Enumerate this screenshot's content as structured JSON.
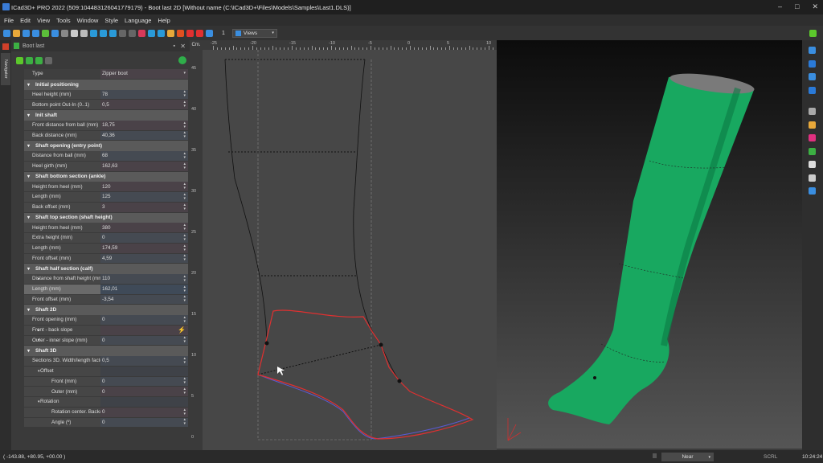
{
  "window": {
    "title": "ICad3D+ PRO 2022 (509:104483126041779179) - Boot last 2D [Without name (C:\\ICad3D+\\Files\\Models\\Samples\\Last1.DLS)]"
  },
  "menu": [
    "File",
    "Edit",
    "View",
    "Tools",
    "Window",
    "Style",
    "Language",
    "Help"
  ],
  "toolbar": {
    "spin_value": "1",
    "views_label": "Views"
  },
  "nav_tab": "Navigator",
  "panel": {
    "title": "Boot last",
    "type_label": "Type",
    "type_value": "Zipper boot"
  },
  "properties": [
    {
      "kind": "section",
      "label": "Initial positioning"
    },
    {
      "kind": "field",
      "label": "Heel height (mm)",
      "value": "78"
    },
    {
      "kind": "field",
      "label": "Bottom point Out-In (0..1)",
      "value": "0,5"
    },
    {
      "kind": "section",
      "label": "Init shaft"
    },
    {
      "kind": "field",
      "label": "Front distance from ball (mm)",
      "value": "18,75"
    },
    {
      "kind": "field",
      "label": "Back distance (mm)",
      "value": "40,36"
    },
    {
      "kind": "section",
      "label": "Shaft opening (entry point)"
    },
    {
      "kind": "field",
      "label": "Distance from ball (mm)",
      "value": "68"
    },
    {
      "kind": "field",
      "label": "Heel girth (mm)",
      "value": "162,63"
    },
    {
      "kind": "section",
      "label": "Shaft bottom section (ankle)"
    },
    {
      "kind": "field",
      "label": "Height from heel (mm)",
      "value": "120"
    },
    {
      "kind": "field",
      "label": "Length (mm)",
      "value": "125"
    },
    {
      "kind": "field",
      "label": "Back offset (mm)",
      "value": "3"
    },
    {
      "kind": "section",
      "label": "Shaft top section (shaft height)"
    },
    {
      "kind": "field",
      "label": "Height from heel (mm)",
      "value": "380"
    },
    {
      "kind": "field",
      "label": "Extra height (mm)",
      "value": "0"
    },
    {
      "kind": "field",
      "label": "Length (mm)",
      "value": "174,59"
    },
    {
      "kind": "field",
      "label": "Front offset (mm)",
      "value": "4,59"
    },
    {
      "kind": "section",
      "label": "Shaft half section (calf)"
    },
    {
      "kind": "field",
      "label": "Distance from shaft height (mm)",
      "value": "110",
      "expand": true
    },
    {
      "kind": "field",
      "label": "Length (mm)",
      "value": "162,01",
      "selected": true
    },
    {
      "kind": "field",
      "label": "Front offset (mm)",
      "value": "-3,54"
    },
    {
      "kind": "section",
      "label": "Shaft 2D"
    },
    {
      "kind": "field",
      "label": "Front opening (mm)",
      "value": "0"
    },
    {
      "kind": "field",
      "label": "Front - back slope",
      "value": "",
      "expand": true,
      "lightning": true
    },
    {
      "kind": "field",
      "label": "Outer - inner slope (mm)",
      "value": "0",
      "expand": true
    },
    {
      "kind": "section",
      "label": "Shaft 3D"
    },
    {
      "kind": "field",
      "label": "Sections 3D. Width/length factor",
      "value": "0,5"
    },
    {
      "kind": "group",
      "label": "Offset"
    },
    {
      "kind": "field",
      "label": "Front (mm)",
      "value": "0",
      "level": 3
    },
    {
      "kind": "field",
      "label": "Outer (mm)",
      "value": "0",
      "level": 3
    },
    {
      "kind": "group",
      "label": "Rotation"
    },
    {
      "kind": "field",
      "label": "Rotation center. Back/front",
      "value": "0",
      "level": 3
    },
    {
      "kind": "field",
      "label": "Angle (º)",
      "value": "0",
      "level": 3
    }
  ],
  "ruler": {
    "unit": "Cm.",
    "h_ticks": [
      "-25",
      "-20",
      "-15",
      "-10",
      "-5",
      "0",
      "5",
      "10"
    ],
    "v_ticks": [
      "45",
      "40",
      "35",
      "30",
      "25",
      "20",
      "15",
      "10",
      "5",
      "0"
    ]
  },
  "status": {
    "coords": "( -143.88, +80.95, +00.00 )",
    "snap": "Near",
    "scrl": "SCRL",
    "time": "10:24:24"
  },
  "colors": {
    "accent_red": "#e03030",
    "boot_green": "#18a860",
    "selection": "#6a6a6a"
  }
}
